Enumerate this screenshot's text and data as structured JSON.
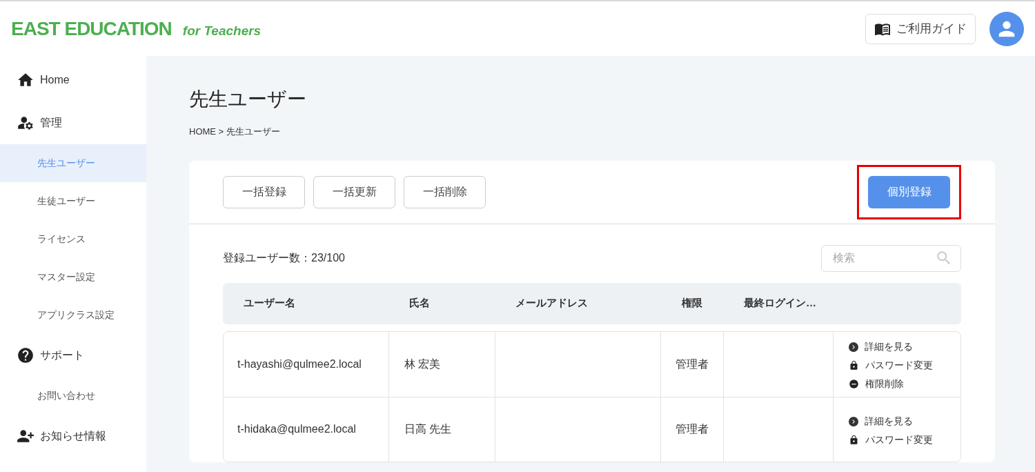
{
  "header": {
    "logo": "EAST EDUCATION",
    "logo_sub": "for Teachers",
    "guide_button": "ご利用ガイド"
  },
  "sidebar": {
    "items": [
      {
        "kind": "home",
        "label": "Home",
        "selected": false
      },
      {
        "kind": "admin",
        "label": "管理",
        "selected": false
      },
      {
        "kind": "link",
        "label": "先生ユーザー",
        "selected": true
      },
      {
        "kind": "link",
        "label": "生徒ユーザー",
        "selected": false
      },
      {
        "kind": "link",
        "label": "ライセンス",
        "selected": false
      },
      {
        "kind": "link",
        "label": "マスター設定",
        "selected": false
      },
      {
        "kind": "link",
        "label": "アプリクラス設定",
        "selected": false
      },
      {
        "kind": "help",
        "label": "サポート",
        "selected": false
      },
      {
        "kind": "link",
        "label": "お問い合わせ",
        "selected": false
      },
      {
        "kind": "news",
        "label": "お知らせ情報",
        "selected": false
      }
    ]
  },
  "page": {
    "title": "先生ユーザー",
    "breadcrumb": "HOME > 先生ユーザー"
  },
  "toolbar": {
    "buttons": [
      {
        "label": "一括登録"
      },
      {
        "label": "一括更新"
      },
      {
        "label": "一括削除"
      }
    ],
    "primary_button": {
      "label": "個別登録",
      "highlighted": true
    }
  },
  "count": "登録ユーザー数：23/100",
  "search": {
    "placeholder": "検索"
  },
  "table": {
    "columns": [
      "ユーザー名",
      "氏名",
      "メールアドレス",
      "権限",
      "最終ログイン…"
    ],
    "rows": [
      {
        "cells": [
          "t-hayashi@qulmee2.local",
          "林 宏美",
          "",
          "管理者",
          ""
        ],
        "actions": [
          {
            "kind": "view",
            "label": "詳細を見る"
          },
          {
            "kind": "password",
            "label": "パスワード変更"
          },
          {
            "kind": "revoke",
            "label": "権限削除"
          }
        ]
      },
      {
        "cells": [
          "t-hidaka@qulmee2.local",
          "日高 先生",
          "",
          "管理者",
          ""
        ],
        "actions": [
          {
            "kind": "view",
            "label": "詳細を見る"
          },
          {
            "kind": "password",
            "label": "パスワード変更"
          }
        ]
      }
    ]
  }
}
